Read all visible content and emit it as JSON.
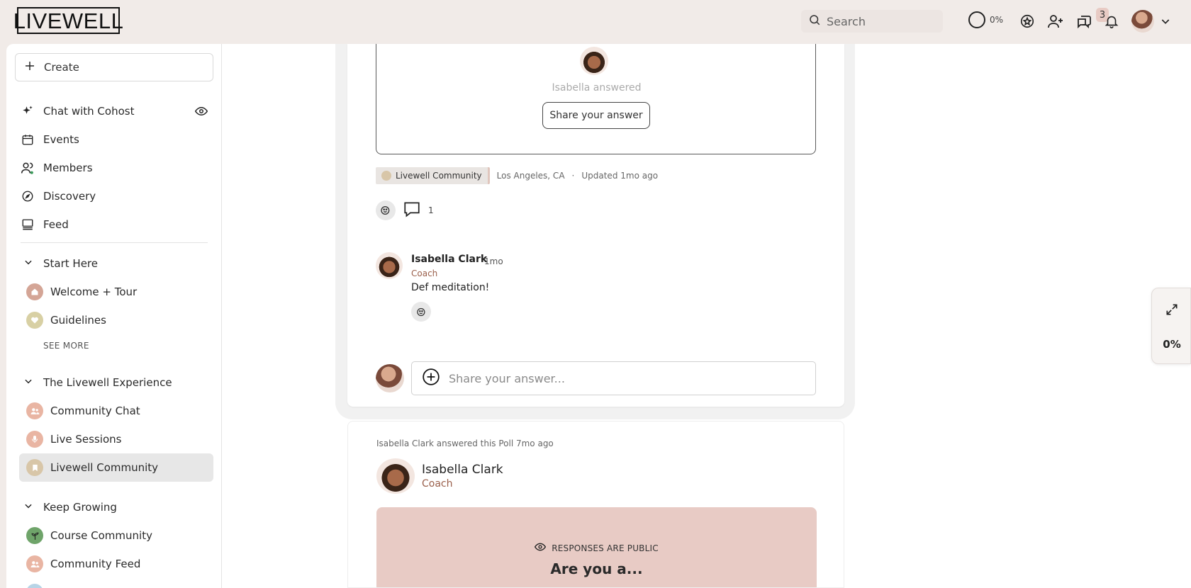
{
  "app": {
    "logo_text": "LIVEWELL"
  },
  "header": {
    "search_placeholder": "Search",
    "progress_text": "0%",
    "notification_count": "3"
  },
  "sidebar": {
    "create_label": "Create",
    "nav": [
      {
        "label": "Chat with Cohost",
        "icon": "sparkle-icon"
      },
      {
        "label": "Events",
        "icon": "calendar-icon"
      },
      {
        "label": "Members",
        "icon": "members-icon"
      },
      {
        "label": "Discovery",
        "icon": "compass-icon"
      },
      {
        "label": "Feed",
        "icon": "feed-icon"
      }
    ],
    "sections": [
      {
        "title": "Start Here",
        "items": [
          {
            "label": "Welcome + Tour",
            "color": "#d4a596"
          },
          {
            "label": "Guidelines",
            "color": "#d8d0a4"
          }
        ],
        "see_more": "SEE MORE"
      },
      {
        "title": "The Livewell Experience",
        "items": [
          {
            "label": "Community Chat",
            "color": "#e9b5a3"
          },
          {
            "label": "Live Sessions",
            "color": "#e9b5a3"
          },
          {
            "label": "Livewell Community",
            "color": "#d8c6a8"
          }
        ]
      },
      {
        "title": "Keep Growing",
        "items": [
          {
            "label": "Course Community",
            "color": "#6fa46a"
          },
          {
            "label": "Community Feed",
            "color": "#e9b5a3"
          }
        ]
      }
    ]
  },
  "post1": {
    "answered_text": "Isabella answered",
    "share_button": "Share your answer",
    "tag": "Livewell Community",
    "location": "Los Angeles, CA",
    "updated": "Updated 1mo ago",
    "comment_count": "1",
    "comment": {
      "name": "Isabella Clark",
      "time": "1mo",
      "role": "Coach",
      "text": "Def meditation!"
    },
    "answer_placeholder": "Share your answer..."
  },
  "post2": {
    "meta": "Isabella Clark answered this Poll 7mo ago",
    "name": "Isabella Clark",
    "role": "Coach",
    "public_label": "RESPONSES ARE PUBLIC",
    "question": "Are you a..."
  },
  "widget": {
    "percent": "0%"
  },
  "colors": {
    "accent_role": "#9a5f4a",
    "poll_banner": "#e8cbc5",
    "background": "#f1ebe8"
  }
}
